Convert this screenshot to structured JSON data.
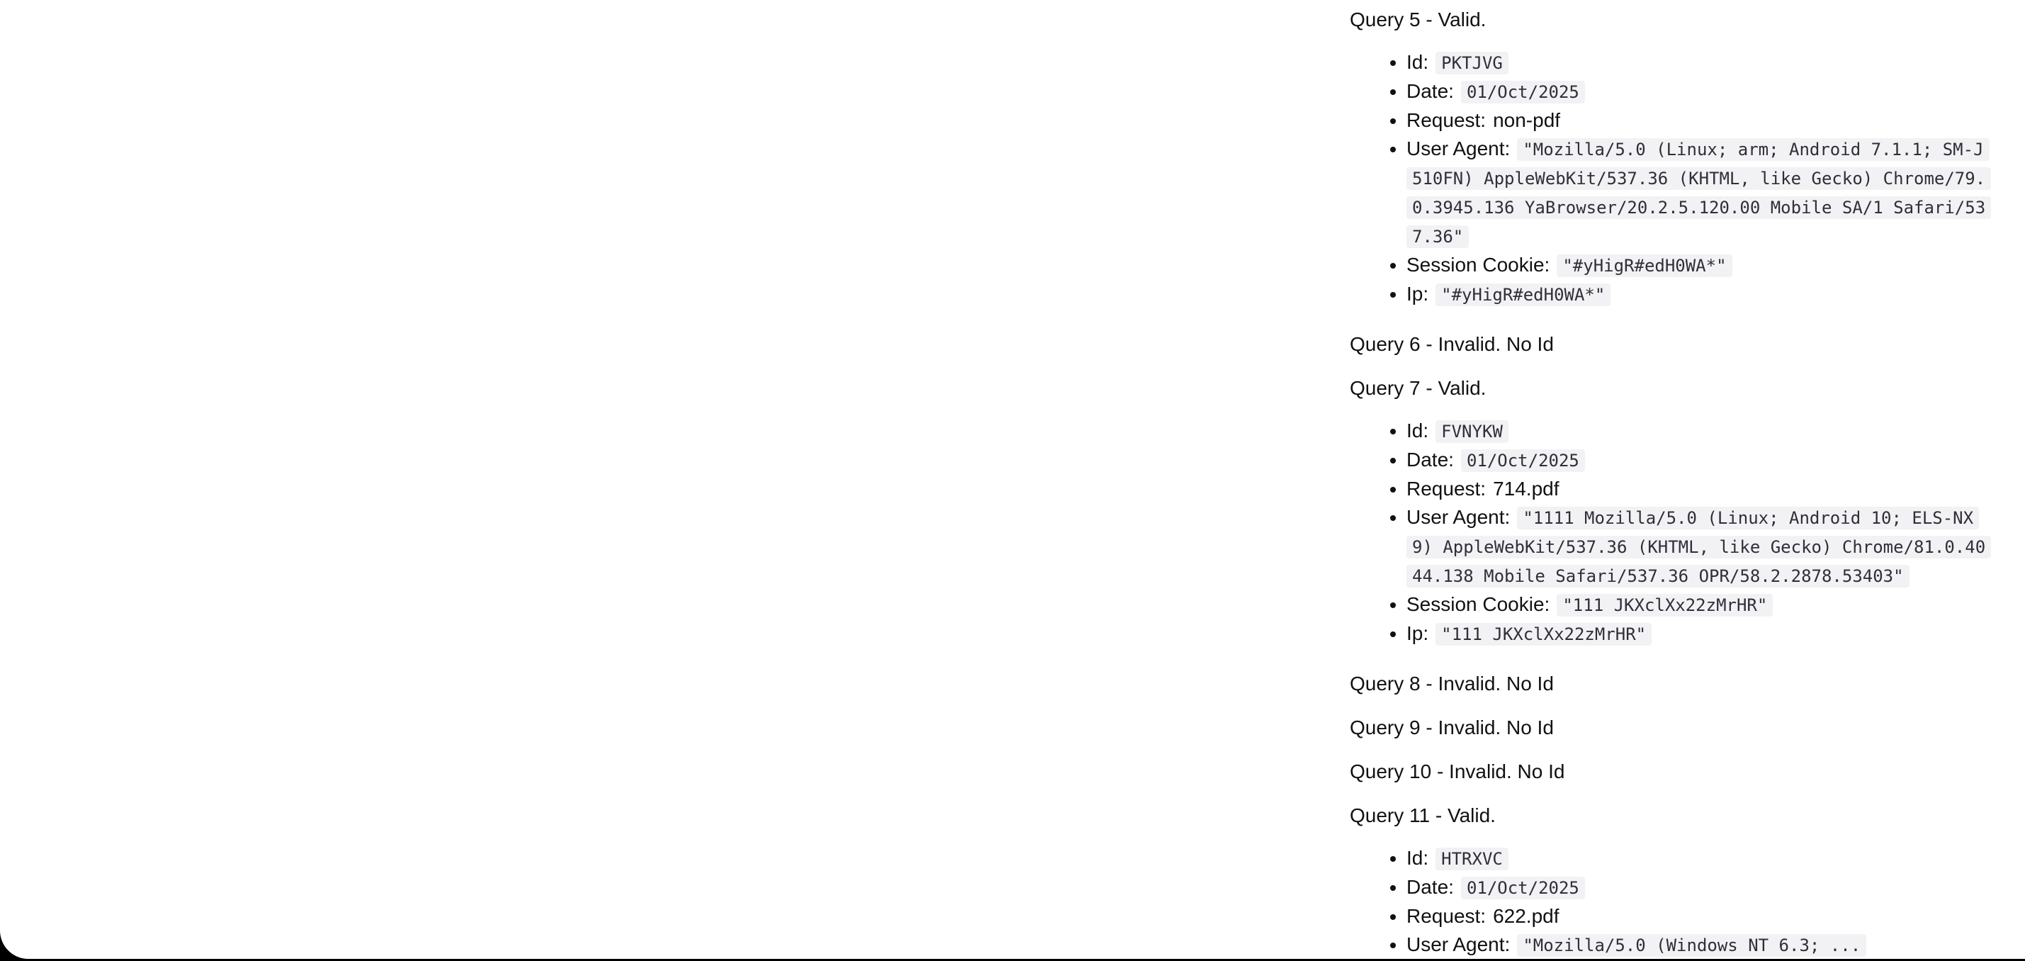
{
  "queries": [
    {
      "heading": "Query 5 - Valid.",
      "fields": {
        "id_label": "Id:",
        "id": "PKTJVG",
        "date_label": "Date:",
        "date": "01/Oct/2025",
        "request_label": "Request:",
        "request": "non-pdf",
        "user_agent_label": "User Agent:",
        "user_agent": "\"Mozilla/5.0 (Linux; arm; Android 7.1.1; SM-J510FN) AppleWebKit/537.36 (KHTML, like Gecko) Chrome/79.0.3945.136 YaBrowser/20.2.5.120.00 Mobile SA/1 Safari/537.36\"",
        "session_cookie_label": "Session Cookie:",
        "session_cookie": "\"#yHigR#edH0WA*\"",
        "ip_label": "Ip:",
        "ip": "\"#yHigR#edH0WA*\""
      }
    },
    {
      "heading": "Query 6 - Invalid. No Id"
    },
    {
      "heading": "Query 7 - Valid.",
      "fields": {
        "id_label": "Id:",
        "id": "FVNYKW",
        "date_label": "Date:",
        "date": "01/Oct/2025",
        "request_label": "Request:",
        "request": "714.pdf",
        "user_agent_label": "User Agent:",
        "user_agent": "\"1111 Mozilla/5.0 (Linux; Android 10; ELS-NX9) AppleWebKit/537.36 (KHTML, like Gecko) Chrome/81.0.4044.138 Mobile Safari/537.36 OPR/58.2.2878.53403\"",
        "session_cookie_label": "Session Cookie:",
        "session_cookie": "\"111 JKXclXx22zMrHR\"",
        "ip_label": "Ip:",
        "ip": "\"111 JKXclXx22zMrHR\""
      }
    },
    {
      "heading": "Query 8 - Invalid. No Id"
    },
    {
      "heading": "Query 9 - Invalid. No Id"
    },
    {
      "heading": "Query 10 - Invalid. No Id"
    },
    {
      "heading": "Query 11 - Valid.",
      "fields": {
        "id_label": "Id:",
        "id": "HTRXVC",
        "date_label": "Date:",
        "date": "01/Oct/2025",
        "request_label": "Request:",
        "request": "622.pdf",
        "user_agent_label": "User Agent:",
        "user_agent": "\"Mozilla/5.0 (Windows NT 6.3; ..."
      }
    }
  ]
}
